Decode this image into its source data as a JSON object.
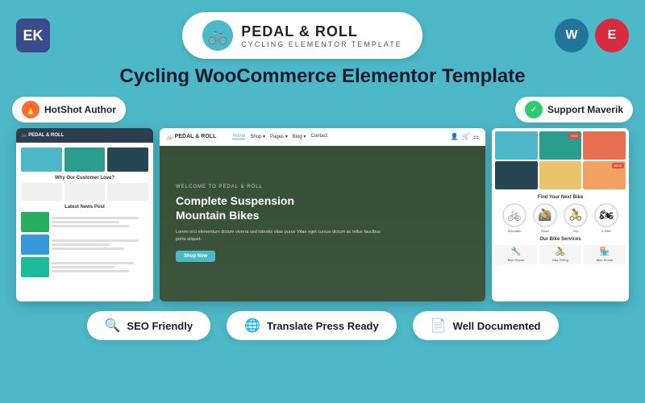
{
  "top": {
    "ek_logo": "EK",
    "wordpress_logo": "W",
    "elementor_logo": "E",
    "center_logo_title": "PEDAL & ROLL",
    "center_logo_sub": "CYCLING ELEMENTOR TEMPLATE",
    "center_logo_icon": "🚲"
  },
  "main_title": "Cycling WooCommerce Elementor Template",
  "author_badge": {
    "icon": "🔥",
    "text": "HotShot Author"
  },
  "support_badge": {
    "icon": "✓",
    "text": "Support Maverik"
  },
  "hero": {
    "welcome": "WELCOME TO PEDAL & ROLL",
    "title": "Complete Suspension\nMountain Bikes",
    "desc": "Lorem orci elementum dictum viverra sed lobortis vitae purus Vitae eget cursus dictum ac tellus faucibus porta aliquet.",
    "button": "Shop Now"
  },
  "nav": {
    "logo": "PEDAL & ROLL",
    "links": [
      "Home",
      "Shop",
      "Pages",
      "Blog",
      "Contact"
    ]
  },
  "left_preview": {
    "section_title_1": "Why Our Customer Love?",
    "section_title_2": "Latest News Post"
  },
  "right_preview": {
    "section_title_1": "Find Your Next Bike",
    "section_title_2": "Our Bike Services",
    "bikes": [
      "🚲",
      "🚵",
      "🚴"
    ],
    "services": [
      "Bike Repair",
      "Bike Fitting",
      "Bike Rental"
    ]
  },
  "badges": [
    {
      "icon": "🔍",
      "text": "SEO Friendly"
    },
    {
      "icon": "🌐",
      "text": "Translate Press Ready"
    },
    {
      "icon": "📄",
      "text": "Well Documented"
    }
  ]
}
